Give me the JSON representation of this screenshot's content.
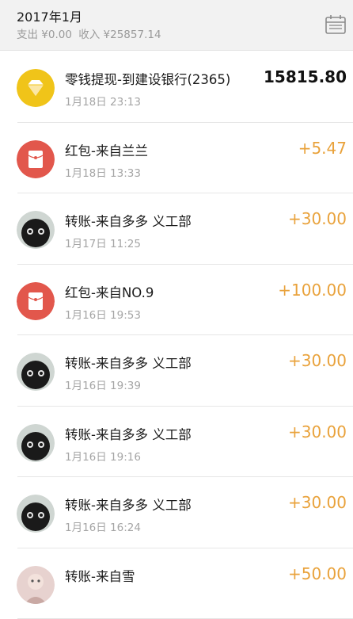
{
  "header": {
    "month": "2017年1月",
    "expense": "支出 ¥0.00",
    "income": "收入 ¥25857.14"
  },
  "colors": {
    "income": "#e9a23b",
    "diamond_bg": "#f0c419",
    "redpacket_bg": "#e2574c"
  },
  "transactions": [
    {
      "icon": "diamond-icon",
      "title": "零钱提现-到建设银行(2365)",
      "time": "1月18日 23:13",
      "amount": "15815.80",
      "type": "out"
    },
    {
      "icon": "red-packet-icon",
      "title": "红包-来自兰兰",
      "time": "1月18日 13:33",
      "amount": "+5.47",
      "type": "in"
    },
    {
      "icon": "user-avatar-icon",
      "title": "转账-来自多多 义工部",
      "time": "1月17日 11:25",
      "amount": "+30.00",
      "type": "in"
    },
    {
      "icon": "red-packet-icon",
      "title": "红包-来自NO.9",
      "time": "1月16日 19:53",
      "amount": "+100.00",
      "type": "in"
    },
    {
      "icon": "user-avatar-icon",
      "title": "转账-来自多多 义工部",
      "time": "1月16日 19:39",
      "amount": "+30.00",
      "type": "in"
    },
    {
      "icon": "user-avatar-icon",
      "title": "转账-来自多多 义工部",
      "time": "1月16日 19:16",
      "amount": "+30.00",
      "type": "in"
    },
    {
      "icon": "user-avatar-icon",
      "title": "转账-来自多多 义工部",
      "time": "1月16日 16:24",
      "amount": "+30.00",
      "type": "in"
    },
    {
      "icon": "user-avatar-photo-icon",
      "title": "转账-来自雪",
      "time": "",
      "amount": "+50.00",
      "type": "in"
    }
  ]
}
